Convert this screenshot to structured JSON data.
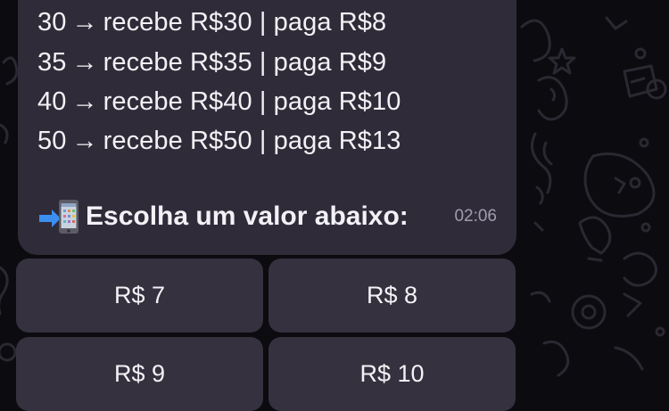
{
  "message": {
    "price_lines": [
      {
        "qty": "30",
        "arrow": "→",
        "text": "recebe R$30 | paga R$8"
      },
      {
        "qty": "35",
        "arrow": "→",
        "text": "recebe R$35 | paga R$9"
      },
      {
        "qty": "40",
        "arrow": "→",
        "text": "recebe R$40 | paga R$10"
      },
      {
        "qty": "50",
        "arrow": "→",
        "text": "recebe R$50 | paga R$13"
      }
    ],
    "cta_text": "Escolha um valor abaixo:",
    "cta_icon": "mobile-phone-arrow-icon",
    "timestamp": "02:06"
  },
  "keyboard": {
    "buttons": [
      {
        "label": "R$ 7"
      },
      {
        "label": "R$ 8"
      },
      {
        "label": "R$ 9"
      },
      {
        "label": "R$ 10"
      }
    ]
  },
  "colors": {
    "background": "#0c0b10",
    "bubble": "#2f2b39",
    "button": "#35313f",
    "text": "#f2f1f5",
    "timestamp": "#a19db0"
  }
}
